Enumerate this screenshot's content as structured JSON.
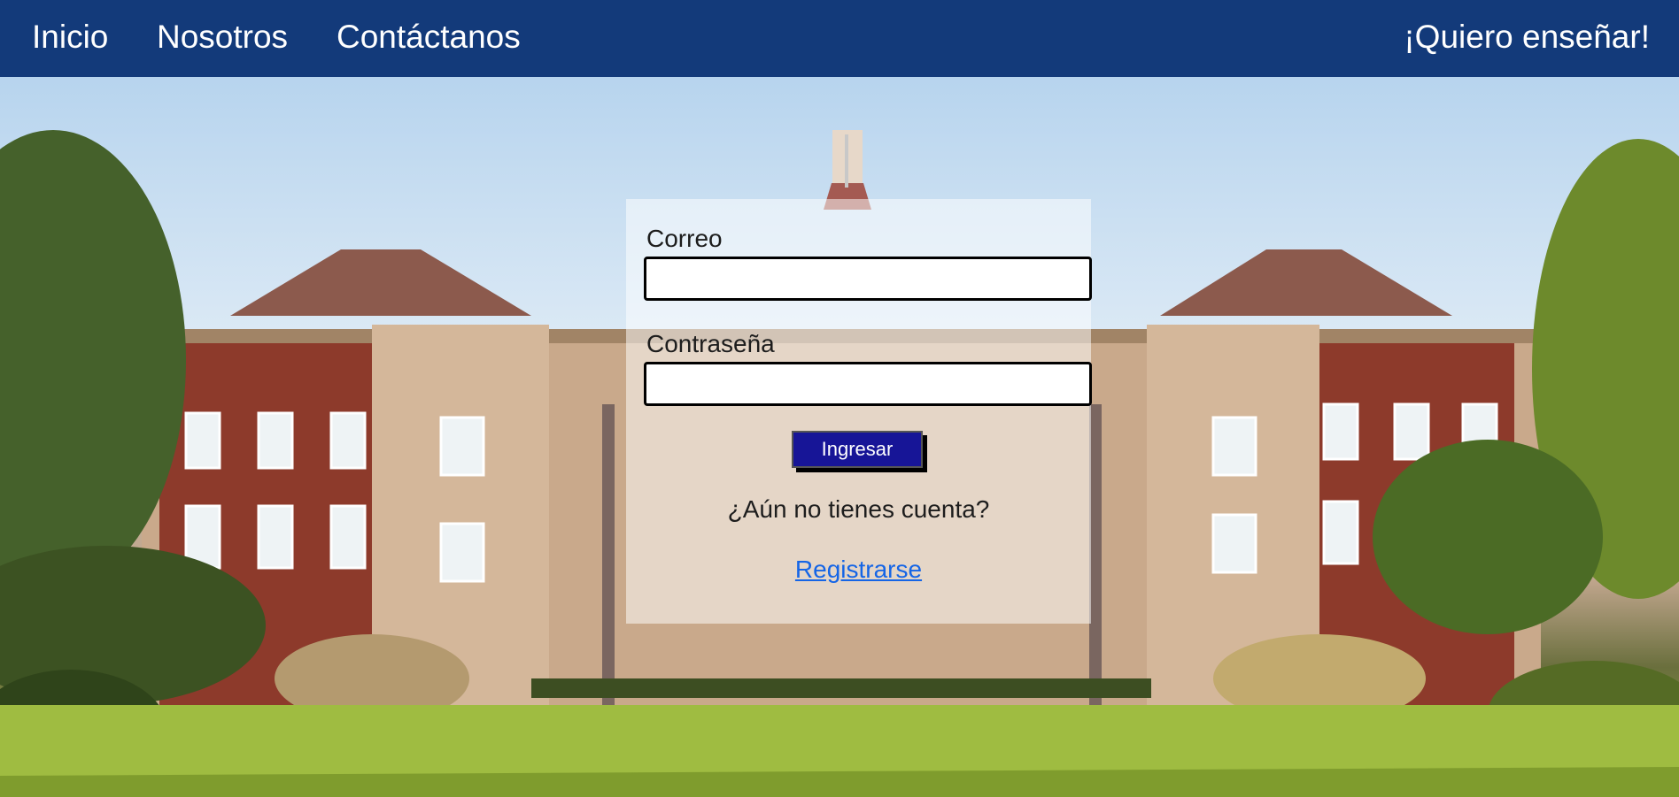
{
  "nav": {
    "links": [
      "Inicio",
      "Nosotros",
      "Contáctanos"
    ],
    "cta": "¡Quiero enseñar!"
  },
  "login": {
    "email_label": "Correo",
    "email_value": "",
    "password_label": "Contraseña",
    "password_value": "",
    "submit_label": "Ingresar",
    "signup_prompt": "¿Aún no tienes cuenta?",
    "signup_link": "Registrarse"
  },
  "colors": {
    "navbar": "#133a7a",
    "button": "#171597",
    "link": "#1565e6"
  }
}
